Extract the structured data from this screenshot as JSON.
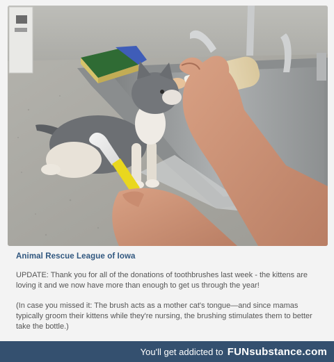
{
  "post": {
    "source": "Animal Rescue League of Iowa",
    "update": "UPDATE: Thank you for all of the donations of toothbrushes last week - the kittens are loving it and we now have more than enough to get us through the year!",
    "explanation": "(In case you missed it: The brush acts as a mother cat's tongue—and since mamas typically groom their kittens while they're nursing, the brushing stimulates them to better take the bottle.)"
  },
  "footer": {
    "tagline": "You'll get addicted to",
    "brand": "FUNsubstance.com"
  },
  "colors": {
    "source_link": "#30577f",
    "footer_bg": "#34506f",
    "text": "#555555"
  }
}
